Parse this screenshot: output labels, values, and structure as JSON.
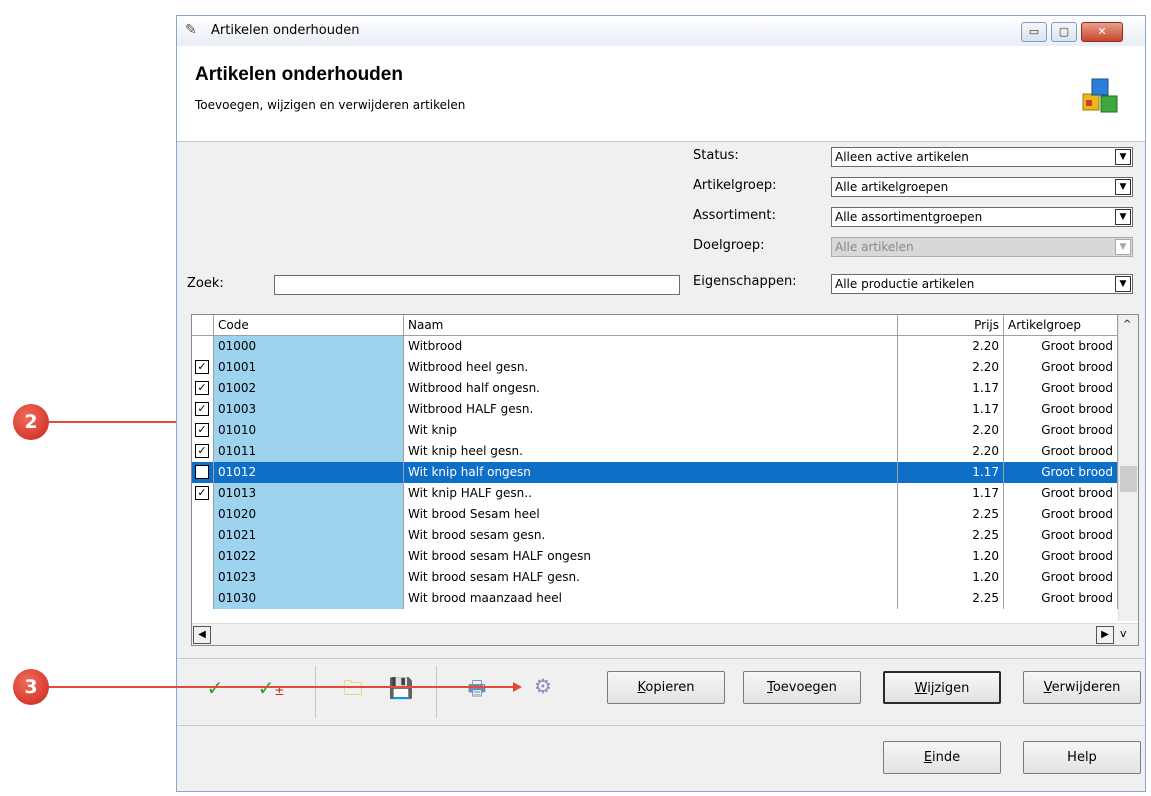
{
  "window": {
    "title": "Artikelen onderhouden",
    "min_label": "▭",
    "max_label": "▢",
    "close_label": "✕"
  },
  "header": {
    "title": "Artikelen onderhouden",
    "subtitle": "Toevoegen, wijzigen en verwijderen artikelen"
  },
  "filters": {
    "status": {
      "label": "Status:",
      "value": "Alleen active artikelen"
    },
    "artikelgroep": {
      "label": "Artikelgroep:",
      "value": "Alle artikelgroepen"
    },
    "assortiment": {
      "label": "Assortiment:",
      "value": "Alle assortimentgroepen"
    },
    "doelgroep": {
      "label": "Doelgroep:",
      "value": "Alle artikelen"
    },
    "eigenschappen": {
      "label": "Eigenschappen:",
      "value": "Alle productie artikelen"
    },
    "zoek": {
      "label": "Zoek:",
      "value": ""
    }
  },
  "grid": {
    "columns": {
      "code": "Code",
      "naam": "Naam",
      "prijs": "Prijs",
      "artikelgroep": "Artikelgroep"
    },
    "rows": [
      {
        "checked": false,
        "code": "01000",
        "naam": "Witbrood",
        "prijs": "2.20",
        "groep": "Groot brood"
      },
      {
        "checked": true,
        "code": "01001",
        "naam": "Witbrood heel gesn.",
        "prijs": "2.20",
        "groep": "Groot brood"
      },
      {
        "checked": true,
        "code": "01002",
        "naam": "Witbrood half ongesn.",
        "prijs": "1.17",
        "groep": "Groot brood"
      },
      {
        "checked": true,
        "code": "01003",
        "naam": "Witbrood HALF gesn.",
        "prijs": "1.17",
        "groep": "Groot brood"
      },
      {
        "checked": true,
        "code": "01010",
        "naam": "Wit knip",
        "prijs": "2.20",
        "groep": "Groot brood"
      },
      {
        "checked": true,
        "code": "01011",
        "naam": "Wit knip heel gesn.",
        "prijs": "2.20",
        "groep": "Groot brood"
      },
      {
        "checked": true,
        "code": "01012",
        "naam": "Wit knip half ongesn",
        "prijs": "1.17",
        "groep": "Groot brood",
        "selected": true
      },
      {
        "checked": true,
        "code": "01013",
        "naam": "Wit knip HALF gesn..",
        "prijs": "1.17",
        "groep": "Groot brood"
      },
      {
        "checked": false,
        "code": "01020",
        "naam": "Wit brood Sesam heel",
        "prijs": "2.25",
        "groep": "Groot brood"
      },
      {
        "checked": false,
        "code": "01021",
        "naam": "Wit brood sesam gesn.",
        "prijs": "2.25",
        "groep": "Groot brood"
      },
      {
        "checked": false,
        "code": "01022",
        "naam": "Wit brood sesam HALF ongesn",
        "prijs": "1.20",
        "groep": "Groot brood"
      },
      {
        "checked": false,
        "code": "01023",
        "naam": "Wit brood sesam HALF gesn.",
        "prijs": "1.20",
        "groep": "Groot brood"
      },
      {
        "checked": false,
        "code": "01030",
        "naam": "Wit brood maanzaad heel",
        "prijs": "2.25",
        "groep": "Groot brood"
      }
    ]
  },
  "toolbar": {
    "icons": [
      "check-all-icon",
      "check-toggle-icon",
      "folder-icon",
      "save-icon",
      "print-icon",
      "settings-icon"
    ]
  },
  "buttons": {
    "kopieren": {
      "first": "K",
      "rest": "opieren"
    },
    "toevoegen": {
      "first": "T",
      "rest": "oevoegen"
    },
    "wijzigen": {
      "first": "W",
      "rest": "ijzigen"
    },
    "verwijderen": {
      "first": "V",
      "rest": "erwijderen"
    },
    "einde": {
      "first": "E",
      "rest": "inde"
    },
    "help": "Help"
  },
  "annotations": {
    "badge2": "2",
    "badge3": "3"
  },
  "colors": {
    "accent": "#0e6fc9",
    "code_col": "#9ed3f0",
    "badge": "#d8362a"
  }
}
